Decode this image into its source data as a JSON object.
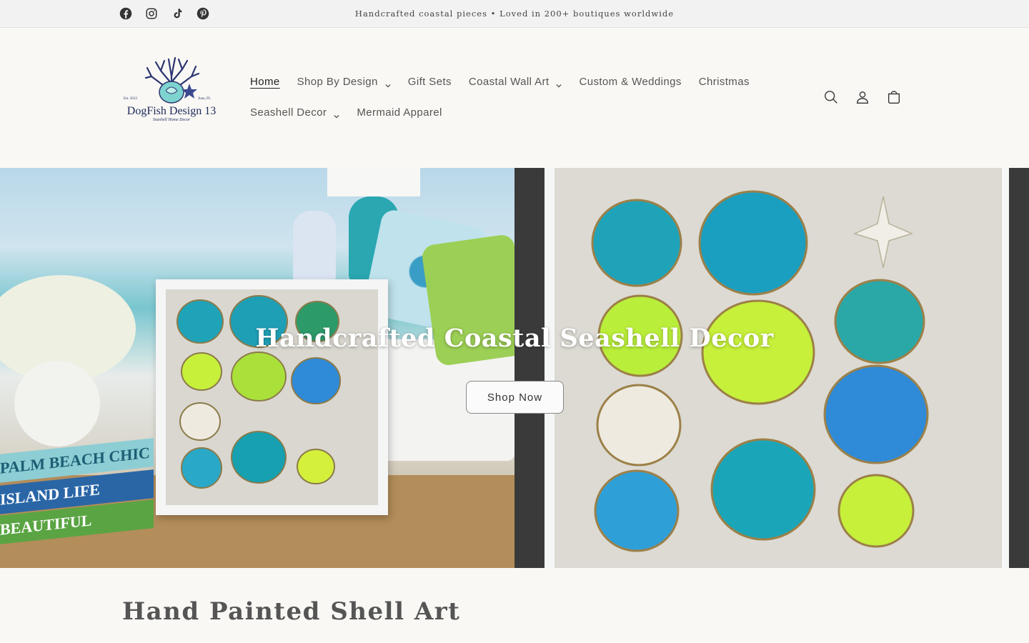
{
  "announcement": {
    "text": "Handcrafted coastal pieces • Loved in 200+ boutiques worldwide",
    "social": [
      "facebook-icon",
      "instagram-icon",
      "tiktok-icon",
      "pinterest-icon"
    ]
  },
  "logo": {
    "name": "DogFish Design 13",
    "tagline": "Seashell Home Decor",
    "est": "Est. 2013",
    "location": "Juno, FL"
  },
  "nav": {
    "row1": [
      {
        "label": "Home",
        "active": true,
        "dropdown": false
      },
      {
        "label": "Shop By Design",
        "active": false,
        "dropdown": true
      },
      {
        "label": "Gift Sets",
        "active": false,
        "dropdown": false
      },
      {
        "label": "Coastal Wall Art",
        "active": false,
        "dropdown": true
      },
      {
        "label": "Custom & Weddings",
        "active": false,
        "dropdown": false
      },
      {
        "label": "Christmas",
        "active": false,
        "dropdown": false
      }
    ],
    "row2": [
      {
        "label": "Seashell Decor",
        "active": false,
        "dropdown": true
      },
      {
        "label": "Mermaid Apparel",
        "active": false,
        "dropdown": false
      }
    ]
  },
  "header_icons": [
    "search-icon",
    "account-icon",
    "cart-icon"
  ],
  "hero": {
    "title": "Handcrafted Coastal Seashell Decor",
    "button": "Shop Now",
    "books": [
      "PALM BEACH CHIC",
      "ISLAND LIFE",
      "BEAUTIFUL"
    ]
  },
  "section": {
    "title": "Hand Painted Shell Art"
  },
  "colors": {
    "background": "#f9f8f5",
    "announcement_bg": "#f2f2f2",
    "logo_navy": "#1e2a5a",
    "shell_teal": "#1fa3b8",
    "shell_lime": "#c6f03a",
    "shell_blue": "#2f8ad8"
  }
}
